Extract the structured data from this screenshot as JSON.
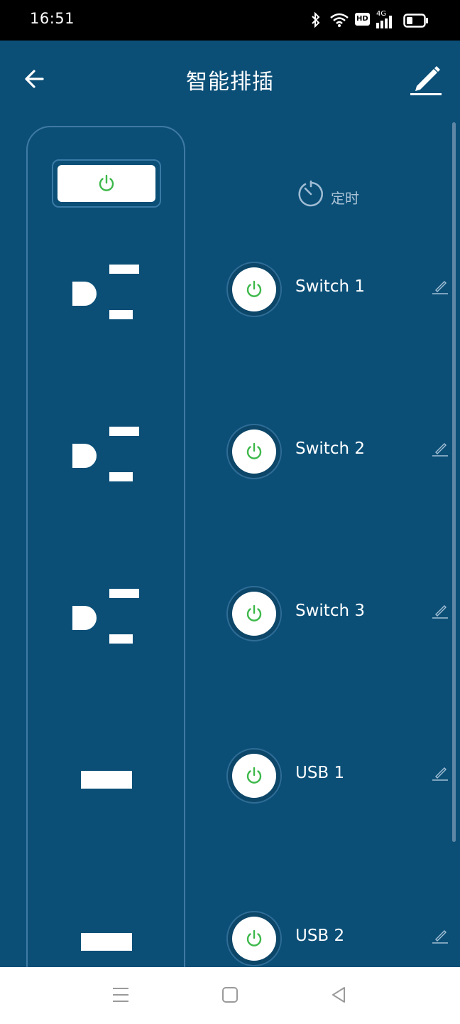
{
  "status_bar": {
    "time": "16:51",
    "network_badge": "HD",
    "signal_label": "4G"
  },
  "app_bar": {
    "title": "智能排插"
  },
  "timer": {
    "label": "定时"
  },
  "switches": [
    {
      "label": "Switch 1"
    },
    {
      "label": "Switch 2"
    },
    {
      "label": "Switch 3"
    },
    {
      "label": "USB 1"
    },
    {
      "label": "USB 2"
    }
  ],
  "colors": {
    "background": "#0b4f77",
    "power_icon": "#3db84a",
    "text": "#ffffff",
    "muted_text": "#aac3d6"
  },
  "icons": [
    "back-arrow-icon",
    "pencil-icon",
    "power-icon",
    "stopwatch-icon",
    "edit-pen-icon",
    "bluetooth-icon",
    "wifi-icon",
    "signal-icon",
    "battery-icon",
    "menu-icon",
    "home-icon",
    "back-triangle-icon"
  ]
}
